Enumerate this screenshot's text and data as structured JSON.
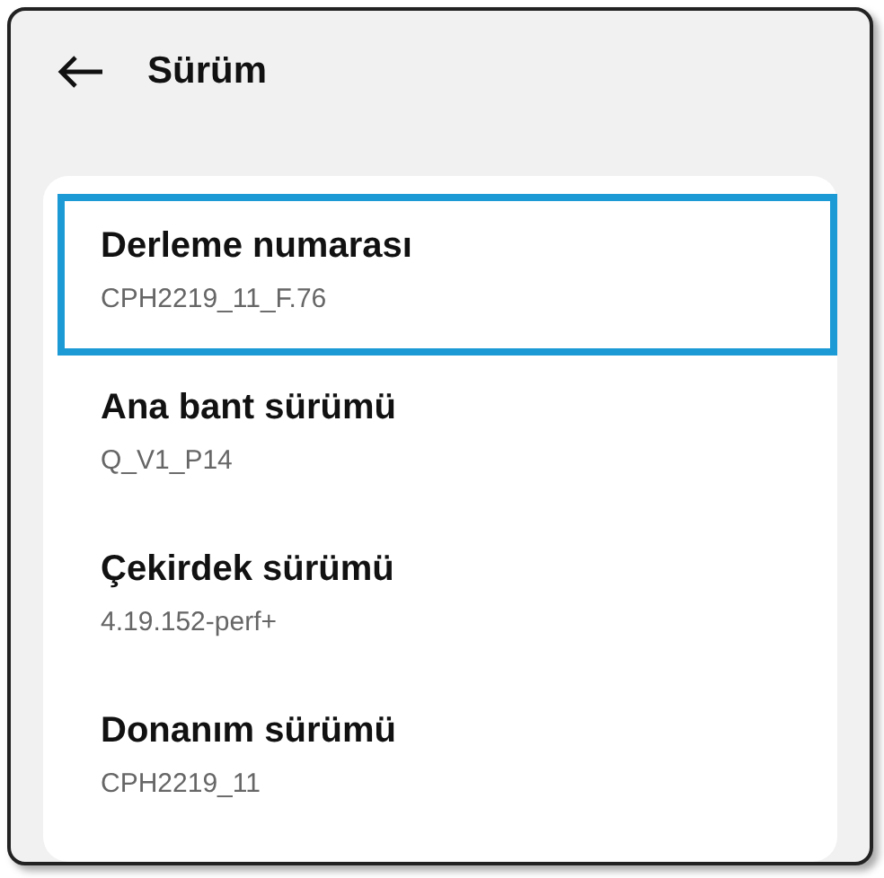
{
  "header": {
    "title": "Sürüm"
  },
  "items": [
    {
      "title": "Derleme numarası",
      "value": "CPH2219_11_F.76",
      "highlighted": true
    },
    {
      "title": "Ana bant sürümü",
      "value": "Q_V1_P14",
      "highlighted": false
    },
    {
      "title": "Çekirdek sürümü",
      "value": "4.19.152-perf+",
      "highlighted": false
    },
    {
      "title": "Donanım sürümü",
      "value": "CPH2219_11",
      "highlighted": false
    }
  ]
}
